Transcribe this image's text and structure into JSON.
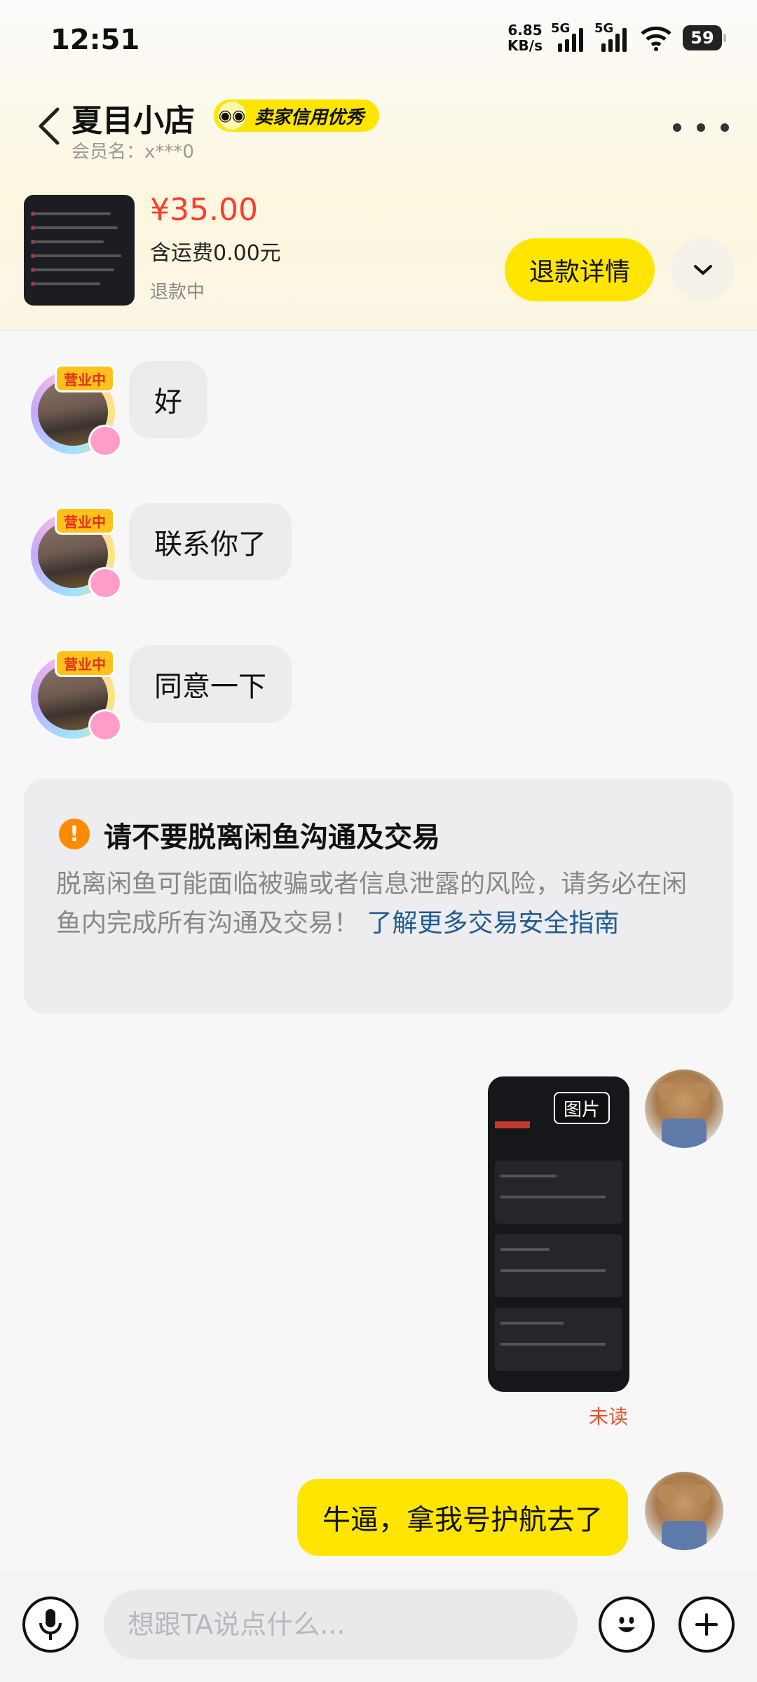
{
  "status_bar": {
    "time": "12:51",
    "net_speed_value": "6.85",
    "net_speed_unit": "KB/s",
    "sim1": "5G",
    "sim2": "5G",
    "battery": "59"
  },
  "header": {
    "shop_name": "夏目小店",
    "credit_badge": "卖家信用优秀",
    "member_name": "会员名：x***0"
  },
  "product": {
    "price": "¥35.00",
    "shipping": "含运费0.00元",
    "status": "退款中",
    "refund_button": "退款详情"
  },
  "messages": {
    "seller_sign": "营业中",
    "m1": "好",
    "m2": "联系你了",
    "m3": "同意一下",
    "image_tag": "图片",
    "unread": "未读",
    "m4": "牛逼，拿我号护航去了"
  },
  "warning": {
    "title": "请不要脱离闲鱼沟通及交易",
    "body": "脱离闲鱼可能面临被骗或者信息泄露的风险，请务必在闲鱼内完成所有沟通及交易！",
    "link": "了解更多交易安全指南"
  },
  "input": {
    "placeholder": "想跟TA说点什么..."
  },
  "colors": {
    "accent_yellow": "#ffe500",
    "price_red": "#ff3b30",
    "link_blue": "#1f5b8f",
    "warning_orange": "#ff8a00"
  },
  "icons": [
    "back-icon",
    "fish-icon",
    "more-icon",
    "chevron-down-icon",
    "warning-icon",
    "mic-icon",
    "emoji-icon",
    "plus-icon"
  ]
}
